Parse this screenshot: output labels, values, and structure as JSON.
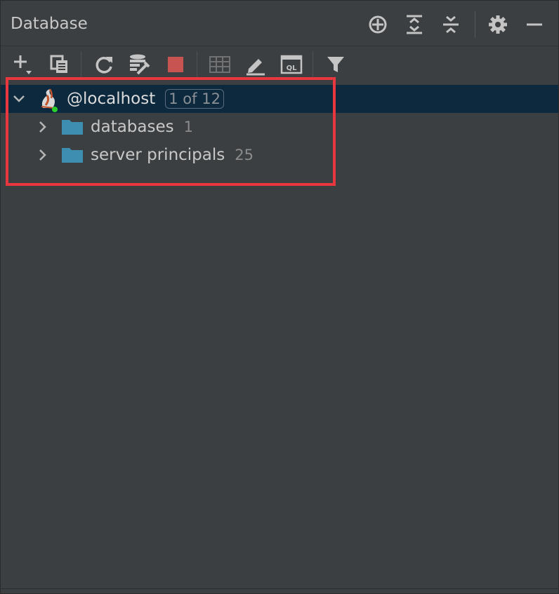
{
  "window": {
    "title": "Database"
  },
  "title_icons": [
    "crosshair-icon",
    "expand-all-icon",
    "collapse-all-icon",
    "gear-icon",
    "minimize-icon"
  ],
  "toolbar": {
    "buttons": [
      "add-icon",
      "duplicate-icon",
      "refresh-icon",
      "data-source-properties-icon",
      "stop-icon",
      "table-editor-icon",
      "edit-icon",
      "query-console-icon",
      "filter-icon"
    ]
  },
  "tree": {
    "root": {
      "label": "@localhost",
      "badge": "1 of 12",
      "expanded": true,
      "selected": true
    },
    "children": [
      {
        "label": "databases",
        "count": "1"
      },
      {
        "label": "server principals",
        "count": "25"
      }
    ]
  },
  "colors": {
    "panel_bg": "#3c3f41",
    "selection_bg": "#0d293e",
    "folder": "#3d8eb1",
    "highlight": "#e8373f",
    "stop": "#c75450",
    "status_dot": "#2ccf2c"
  }
}
